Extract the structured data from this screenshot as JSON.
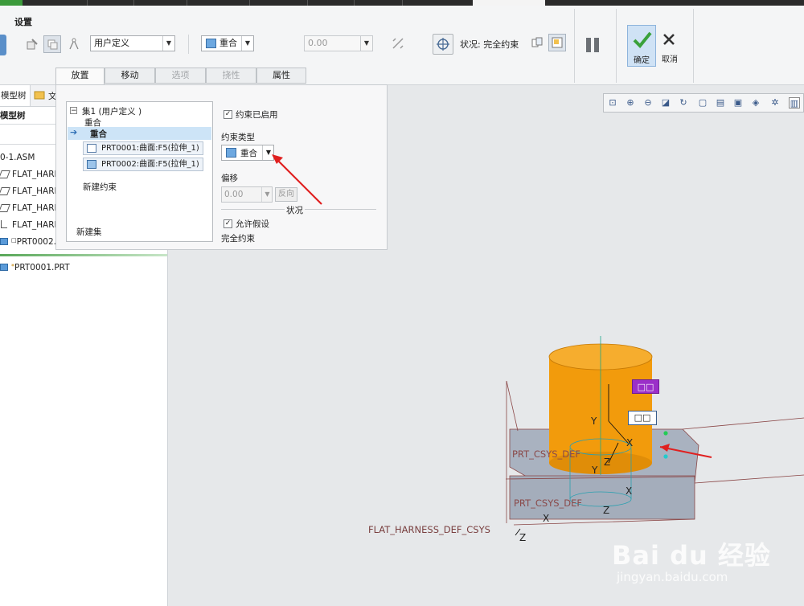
{
  "ribbon": {
    "group_label": "设置",
    "constraint_set_combo": "用户定义",
    "constraint_type_combo": "重合",
    "offset_value": "0.00",
    "status_label": "状况: 完全约束",
    "ok_label": "确定",
    "cancel_label": "取消"
  },
  "panel_tabs": [
    {
      "label": "放置",
      "state": "active"
    },
    {
      "label": "移动",
      "state": "normal"
    },
    {
      "label": "选项",
      "state": "disabled"
    },
    {
      "label": "挠性",
      "state": "disabled"
    },
    {
      "label": "属性",
      "state": "normal"
    }
  ],
  "tree": {
    "tab_label": "模型树",
    "tab2_label": "文",
    "header": "模型树",
    "items": [
      {
        "label": "0-1.ASM"
      },
      {
        "label": "FLAT_HARN"
      },
      {
        "label": "FLAT_HARN"
      },
      {
        "label": "FLAT_HARN"
      },
      {
        "label": "FLAT_HARN"
      },
      {
        "label": "PRT0002."
      }
    ],
    "active_part": "PRT0001.PRT"
  },
  "placement": {
    "set_title": "集1 (用户定义 )",
    "set_sub": "重合",
    "constraint_selected": "重合",
    "references": [
      "PRT0001:曲面:F5(拉伸_1)",
      "PRT0002:曲面:F5(拉伸_1)"
    ],
    "new_constraint": "新建约束",
    "new_set": "新建集",
    "enabled_label": "约束已启用",
    "type_label": "约束类型",
    "type_value": "重合",
    "offset_label": "偏移",
    "offset_value": "0.00",
    "flip_label": "反向",
    "status_label": "状况",
    "allow_assume_label": "允许假设",
    "status_value": "完全约束"
  },
  "viewport": {
    "csys_labels": [
      "PRT_CSYS_DEF",
      "PRT_CSYS_DEF",
      "FLAT_HARNESS_DEF_CSYS"
    ],
    "axis_letters": [
      "Y",
      "X",
      "Z",
      "Y",
      "X",
      "Z",
      "X",
      "Z"
    ],
    "tag_boxes": [
      "□□",
      "□□"
    ],
    "watermark_brand": "Bai du 经验",
    "watermark_url": "jingyan.baidu.com"
  },
  "colors": {
    "accent_blue": "#2f6fb5",
    "ok_green": "#3aa13a",
    "cylinder_orange": "#f29b0c",
    "arrow_red": "#e02020",
    "tag_purple": "#9b2fc9"
  }
}
